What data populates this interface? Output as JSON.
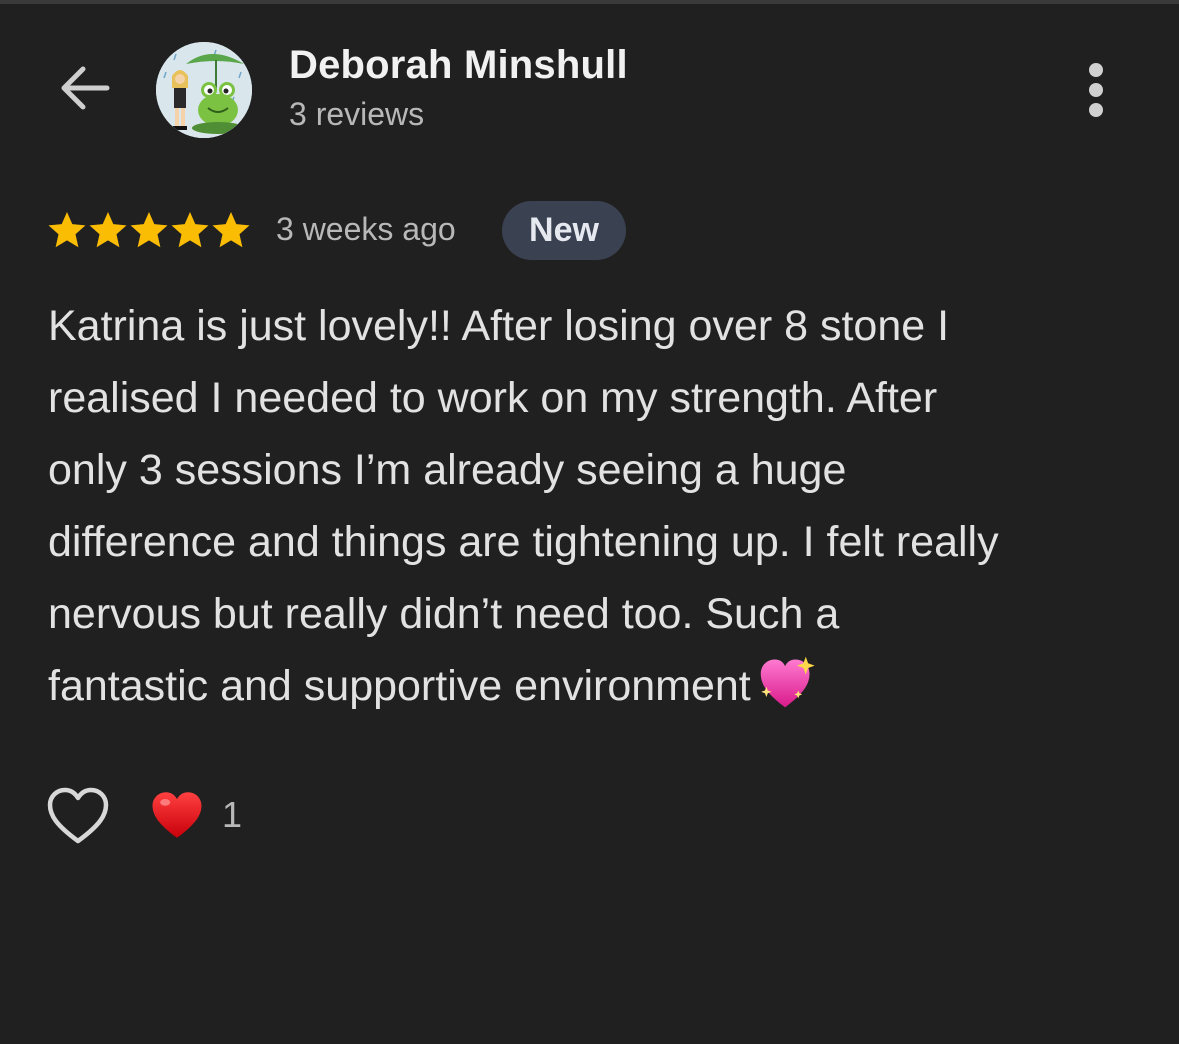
{
  "header": {
    "back_icon": "arrow-left-icon",
    "reviewer_name": "Deborah Minshull",
    "review_count": "3 reviews",
    "more_icon": "more-vertical-icon"
  },
  "review": {
    "rating": 5,
    "rating_max": 5,
    "star_color": "#fbbc04",
    "time_ago": "3 weeks ago",
    "badge": "New",
    "text_lines": [
      "Katrina is just lovely!! After losing over 8 stone I",
      "realised I needed to work on my strength. After",
      "only 3 sessions I’m already seeing a huge",
      "difference and things are tightening up. I felt really",
      "nervous but really didn’t need too. Such a",
      "fantastic and supportive environment"
    ],
    "trailing_emoji": "sparkling-heart-icon"
  },
  "actions": {
    "like_icon": "heart-outline-icon",
    "reaction_icon": "red-heart-icon",
    "reaction_count": "1"
  }
}
